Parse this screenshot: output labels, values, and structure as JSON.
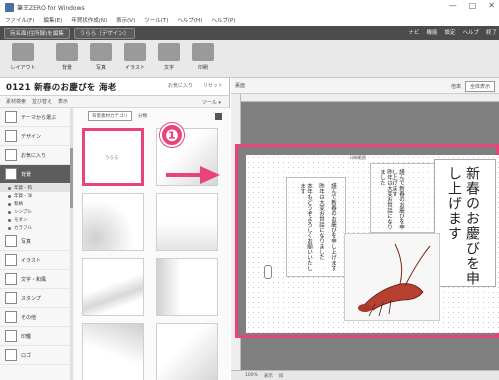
{
  "window": {
    "title": "筆王ZERO for Windows",
    "controls": [
      "—",
      "□",
      "✕"
    ]
  },
  "menu": [
    "ファイル(F)",
    "編集(E)",
    "年賀状作成(N)",
    "表示(V)",
    "ツール(T)",
    "ヘルプ(H)",
    "ヘルプ(P)"
  ],
  "modebar": {
    "buttons": [
      "宛名面(住所録)を編集",
      "うらら（デザイン）"
    ],
    "right_links": [
      "ナビ",
      "機能",
      "設定",
      "ヘルプ",
      "終了"
    ]
  },
  "toolbar": {
    "tools": [
      "レイアウト",
      "背景",
      "写真",
      "イラスト",
      "文字",
      "印刷"
    ]
  },
  "left_panel": {
    "theme_title": "0121 新春のお慶びを 海老",
    "header_links": [
      "お気に入り",
      "リセット"
    ],
    "sub_links": [
      "素材検索",
      "並び替え",
      "表示"
    ],
    "tool_dropdown": "ツール ▾",
    "categories": [
      {
        "label": "テーマから選ぶ",
        "selected": false
      },
      {
        "label": "デザイン",
        "selected": false
      },
      {
        "label": "お気に入り",
        "selected": false
      },
      {
        "label": "背景",
        "selected": true
      }
    ],
    "subcategories": [
      "年賀 - 和",
      "年賀 - 洋",
      "和柄",
      "シンプル",
      "モダン",
      "カラフル"
    ],
    "more_categories": [
      "写真",
      "イラスト",
      "文字・和風",
      "スタンプ",
      "その他",
      "印鑑",
      "ロゴ"
    ],
    "grid_filter": "背景素材カテゴリ",
    "grid_filter2": "分類",
    "selected_thumb_label": "うらら"
  },
  "right_panel": {
    "tab": "裏面",
    "zoom_label": "倍率",
    "zoom_value": "全体表示",
    "card_tag": "印刷範囲",
    "greeting_title": "新春のお慶びを申し上げます",
    "body_lines": [
      "謹んで新春のお慶びを申し上げます",
      "昨年は大変お世話になりました",
      "本年もどうぞよろしくお願いいたします"
    ],
    "status": [
      "100%",
      "表示",
      "枠"
    ]
  },
  "callout": {
    "number": "❶"
  },
  "colors": {
    "accent": "#e8437c",
    "modebar": "#4c4c4c",
    "canvas": "#808080"
  }
}
